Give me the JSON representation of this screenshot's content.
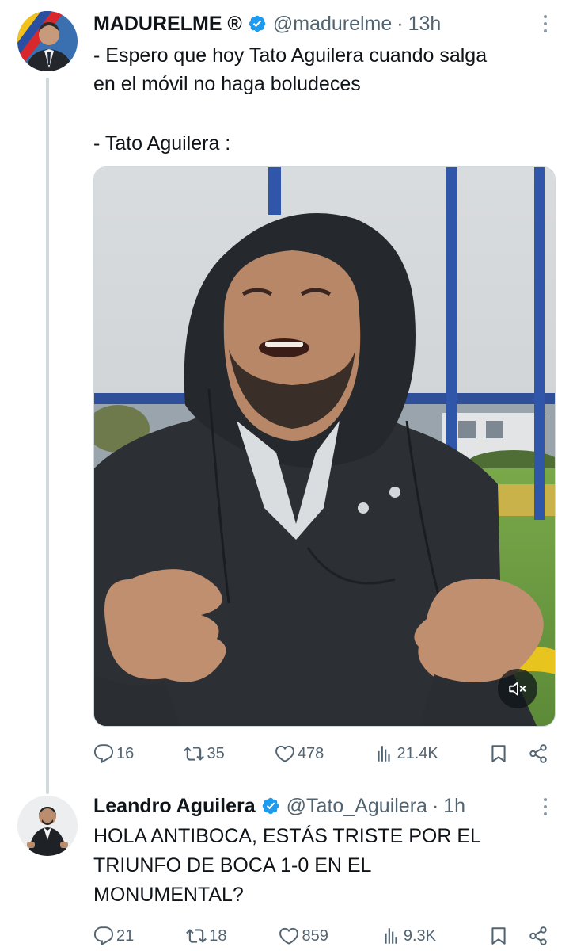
{
  "tweet1": {
    "name": "MADURELME ®",
    "handle": "@madurelme",
    "separator": "·",
    "time": "13h",
    "lines": [
      "- Espero que hoy Tato Aguilera cuando salga",
      "en el móvil no haga boludeces",
      "- Tato Aguilera :"
    ],
    "stats": {
      "replies": "16",
      "reposts": "35",
      "likes": "478",
      "views": "21.4K"
    }
  },
  "tweet2": {
    "name": "Leandro Aguilera",
    "handle": "@Tato_Aguilera",
    "separator": "·",
    "time": "1h",
    "lines": [
      "HOLA ANTIBOCA, ESTÁS TRISTE POR EL",
      "TRIUNFO DE BOCA 1-0 EN EL",
      "MONUMENTAL?"
    ],
    "stats": {
      "replies": "21",
      "reposts": "18",
      "likes": "859",
      "views": "9.3K"
    }
  },
  "icons": {
    "verified": "verified-badge-icon",
    "more": "more-options-icon",
    "reply": "reply-icon",
    "repost": "repost-icon",
    "like": "heart-icon",
    "views": "views-chart-icon",
    "bookmark": "bookmark-icon",
    "share": "share-icon",
    "mute": "muted-speaker-icon"
  },
  "colors": {
    "verified_blue": "#1d9bf0",
    "text_primary": "#0f1419",
    "text_secondary": "#536471",
    "thread_line": "#cfd9de"
  }
}
